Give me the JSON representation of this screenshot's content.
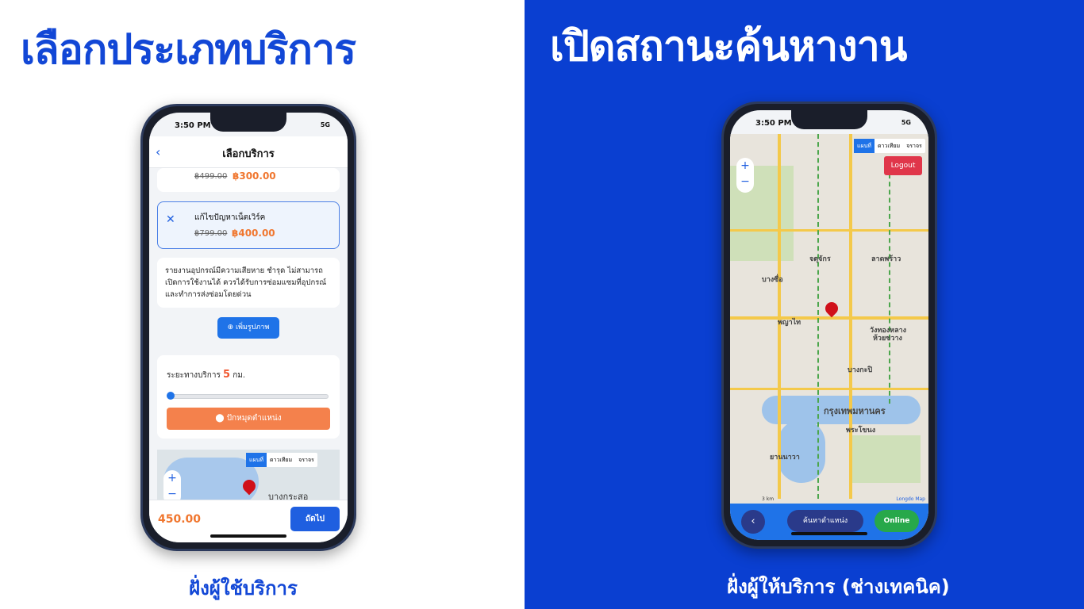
{
  "left": {
    "headline": "เลือกประเภทบริการ",
    "caption": "ฝั่งผู้ใช้บริการ",
    "phone": {
      "time": "3:50 PM",
      "signal": "5G",
      "screen_title": "เลือกบริการ",
      "prev_service": {
        "old_price": "฿499.00",
        "new_price": "฿300.00"
      },
      "selected_service": {
        "name": "แก้ไขปัญหาเน็ตเวิร์ค",
        "old_price": "฿799.00",
        "new_price": "฿400.00"
      },
      "description": "รายงานอุปกรณ์มีความเสียหาย ชำรุด ไม่สามารถเปิดการใช้งานได้ ควรได้รับการซ่อมแซมที่อุปกรณ์และทำการส่งซ่อมโดยด่วน",
      "add_photo_label": "เพิ่มรูปภาพ",
      "distance_label": "ระยะทางบริการ",
      "distance_value": "5",
      "distance_unit": "กม.",
      "distance_fraction": 0.0,
      "pin_button_label": "ปักหมุดตำแหน่ง",
      "map_tabs": [
        "แผนที่",
        "ดาวเทียม",
        "จราจร"
      ],
      "map_label": "บางกระสอ",
      "total": "450.00",
      "next_label": "ถัดไป"
    }
  },
  "right": {
    "headline": "เปิดสถานะค้นหางาน",
    "caption": "ฝั่งผู้ให้บริการ (ช่างเทคนิค)",
    "phone": {
      "time": "3:50 PM",
      "signal": "5G",
      "map_tabs": [
        "แผนที่",
        "ดาวเทียม",
        "จราจร"
      ],
      "logout_label": "Logout",
      "city_labels": [
        "กรุงเทพมหานคร",
        "ลาดพร้าว",
        "ห้วยขวาง",
        "พญาไท",
        "บางกะปิ",
        "พระโขนง",
        "ยานนาวา",
        "บางซื่อ",
        "จตุจักร",
        "วังทองหลาง"
      ],
      "attribution": "Longdo Map",
      "scale": "3 km",
      "search_label": "ค้นหาตำแหน่ง",
      "online_label": "Online"
    }
  },
  "colors": {
    "brand_blue": "#1247d6",
    "right_bg": "#0a3fd1",
    "accent_orange": "#f0762e",
    "online_green": "#27a84a",
    "logout_red": "#e0364a"
  }
}
